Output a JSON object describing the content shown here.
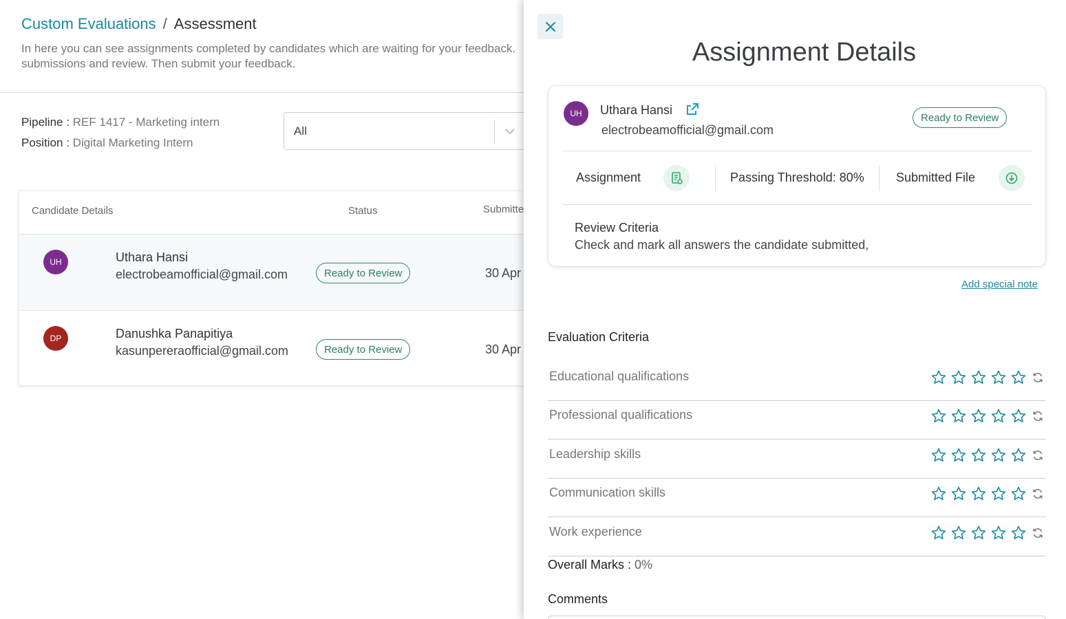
{
  "header": {
    "breadcrumb_link": "Custom Evaluations",
    "breadcrumb_sep": "/",
    "breadcrumb_current": "Assessment",
    "description_line1": "In here you can see assignments completed by candidates which are waiting for your feedback.",
    "description_line2": "submissions and review. Then submit your feedback."
  },
  "filters": {
    "pipeline_label": "Pipeline :",
    "pipeline_value": "REF 1417 - Marketing intern",
    "position_label": "Position :",
    "position_value": "Digital Marketing Intern",
    "select_value": "All"
  },
  "table": {
    "columns": [
      "Candidate Details",
      "Status",
      "Submitted"
    ],
    "rows": [
      {
        "initials": "UH",
        "name": "Uthara Hansi",
        "email": "electrobeamofficial@gmail.com",
        "status": "Ready to Review",
        "date": "30 Apr",
        "avatar_color": "#7b2d8e"
      },
      {
        "initials": "DP",
        "name": "Danushka Panapitiya",
        "email": "kasunpereraofficial@gmail.com",
        "status": "Ready to Review",
        "date": "30 Apr",
        "avatar_color": "#a3261f"
      }
    ]
  },
  "drawer": {
    "title": "Assignment Details",
    "candidate": {
      "initials": "UH",
      "name": "Uthara Hansi",
      "email": "electrobeamofficial@gmail.com",
      "status": "Ready to Review"
    },
    "assignment_label": "Assignment",
    "threshold_label": "Passing Threshold: 80%",
    "submitted_file_label": "Submitted File",
    "review_criteria_title": "Review Criteria",
    "review_criteria_text": "Check and mark all answers the candidate submitted,",
    "special_note_link": "Add special note",
    "evaluation_title": "Evaluation Criteria",
    "criteria": [
      {
        "label": "Educational qualifications",
        "rating": 0,
        "max": 5
      },
      {
        "label": "Professional qualifications",
        "rating": 0,
        "max": 5
      },
      {
        "label": "Leadership skills",
        "rating": 0,
        "max": 5
      },
      {
        "label": "Communication skills",
        "rating": 0,
        "max": 5
      },
      {
        "label": "Work experience",
        "rating": 0,
        "max": 5
      }
    ],
    "overall_label": "Overall Marks :",
    "overall_value": "0%",
    "comments_title": "Comments"
  },
  "colors": {
    "accent": "#1a8a9e",
    "status_green": "#2e8b57",
    "star": "#1a8a9e"
  }
}
